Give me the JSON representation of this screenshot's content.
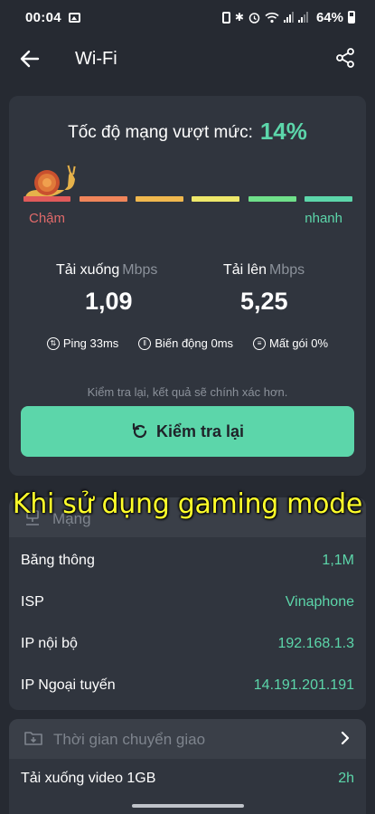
{
  "status_bar": {
    "time": "00:04",
    "battery": "64%"
  },
  "app_bar": {
    "title": "Wi-Fi",
    "back_icon": "arrow-left-icon",
    "share_icon": "share-icon"
  },
  "speed": {
    "prefix": "Tốc độ mạng vượt mức:",
    "percent": "14%",
    "slow_label": "Chậm",
    "fast_label": "nhanh",
    "bar_colors": [
      "#e05a5a",
      "#f0855a",
      "#f0b84e",
      "#eee86a",
      "#6fe08a",
      "#5cd6aa"
    ]
  },
  "download": {
    "label": "Tải xuống",
    "unit": "Mbps",
    "value": "1,09"
  },
  "upload": {
    "label": "Tải lên",
    "unit": "Mbps",
    "value": "5,25"
  },
  "stats": {
    "ping": "Ping 33ms",
    "jitter": "Biến động 0ms",
    "loss": "Mất gói 0%"
  },
  "hint": "Kiểm tra lại, kết quả sẽ chính xác hơn.",
  "retest_label": "Kiểm tra lại",
  "caption": "Khi sử dụng gaming mode",
  "network": {
    "title": "Mạng",
    "rows": [
      {
        "key": "Băng thông",
        "value": "1,1M"
      },
      {
        "key": "ISP",
        "value": "Vinaphone"
      },
      {
        "key": "IP nội bộ",
        "value": "192.168.1.3"
      },
      {
        "key": "IP Ngoại tuyến",
        "value": "14.191.201.191"
      }
    ]
  },
  "transfer": {
    "title": "Thời gian chuyển giao",
    "row": {
      "key": "Tải xuống video 1GB",
      "value": "2h"
    }
  },
  "colors": {
    "accent": "#5cd6aa",
    "background": "#262a32",
    "card": "#30353e"
  }
}
